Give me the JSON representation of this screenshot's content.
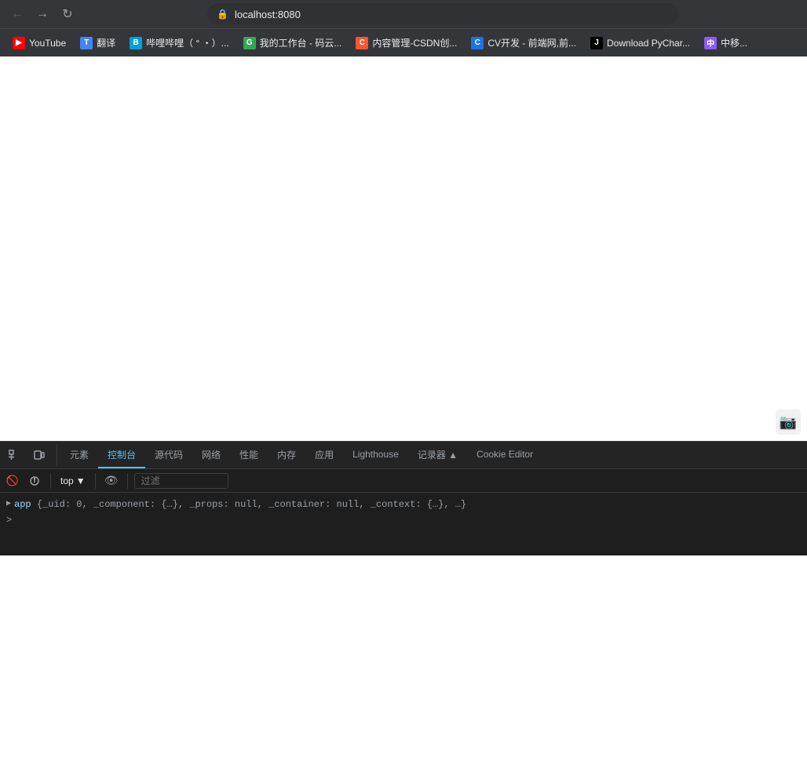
{
  "browser": {
    "title": "localhost:8080",
    "address": "localhost:8080",
    "back_btn": "←",
    "forward_btn": "→",
    "reload_btn": "↻"
  },
  "bookmarks": [
    {
      "id": "youtube",
      "label": "YouTube",
      "color": "fav-youtube",
      "letter": "▶"
    },
    {
      "id": "translate",
      "label": "翻译",
      "color": "fav-translate",
      "letter": "T"
    },
    {
      "id": "bilibili",
      "label": "哔哩哔哩（ ° ・）...",
      "color": "fav-bilibili",
      "letter": "B"
    },
    {
      "id": "work",
      "label": "我的工作台 - 码云...",
      "color": "fav-green",
      "letter": "G"
    },
    {
      "id": "csdn",
      "label": "内容管理-CSDN创...",
      "color": "fav-csdn",
      "letter": "C"
    },
    {
      "id": "cv",
      "label": "CV开发 - 前端网,前...",
      "color": "fav-cv",
      "letter": "C"
    },
    {
      "id": "pycharm",
      "label": "Download PyChar...",
      "color": "fav-jetbrains",
      "letter": "J"
    },
    {
      "id": "more",
      "label": "中移...",
      "color": "fav-more",
      "letter": "中"
    }
  ],
  "devtools": {
    "tabs": [
      {
        "id": "elements",
        "label": "元素",
        "active": false
      },
      {
        "id": "console",
        "label": "控制台",
        "active": true
      },
      {
        "id": "sources",
        "label": "源代码",
        "active": false
      },
      {
        "id": "network",
        "label": "网络",
        "active": false
      },
      {
        "id": "performance",
        "label": "性能",
        "active": false
      },
      {
        "id": "memory",
        "label": "内存",
        "active": false
      },
      {
        "id": "application",
        "label": "应用",
        "active": false
      },
      {
        "id": "lighthouse",
        "label": "Lighthouse",
        "active": false
      },
      {
        "id": "recorder",
        "label": "记录器 ▲",
        "active": false
      },
      {
        "id": "cookie-editor",
        "label": "Cookie Editor",
        "active": false
      }
    ],
    "context": {
      "label": "top",
      "arrow": "▼"
    },
    "filter_placeholder": "过滤",
    "console_output": {
      "line1": {
        "var": "app",
        "expand_arrow": "▶",
        "content": "{_uid: 0, _component: {…}, _props: null, _container: null, _context: {…}, …}"
      }
    },
    "prompt": ">"
  }
}
